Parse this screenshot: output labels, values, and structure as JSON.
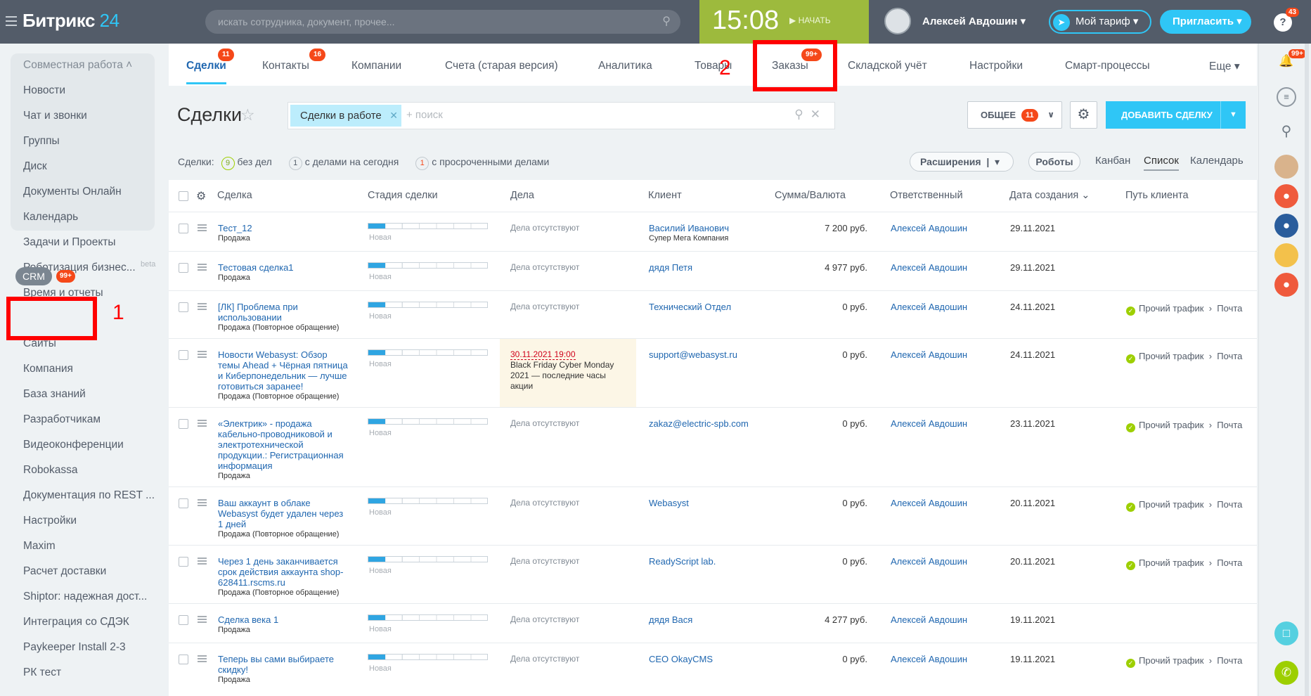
{
  "header": {
    "logo_main": "Битрикс",
    "logo_num": "24",
    "search_placeholder": "искать сотрудника, документ, прочее...",
    "clock_time": "15:08",
    "clock_start": "НАЧАТЬ",
    "user_name": "Алексей Авдошин",
    "tariff_label": "Мой тариф",
    "invite_label": "Пригласить",
    "help_badge": "43"
  },
  "leftnav": {
    "group_title": "Совместная работа",
    "group_items": [
      "Новости",
      "Чат и звонки",
      "Группы",
      "Диск",
      "Документы Онлайн",
      "Календарь"
    ],
    "items": [
      "Задачи и Проекты",
      "Роботизация бизнес...",
      "Время и отчеты"
    ],
    "beta": "beta",
    "crm_label": "CRM",
    "crm_badge": "99+",
    "items2": [
      "Сайты",
      "Компания",
      "База знаний",
      "Разработчикам",
      "Видеоконференции",
      "Robokassa",
      "Документация по REST ...",
      "Настройки",
      "Maxim",
      "Расчет доставки",
      "Shiptor: надежная дост...",
      "Интеграция со СДЭК",
      "Paykeeper Install 2-3",
      "РК тест"
    ]
  },
  "annotations": {
    "label1": "1",
    "label2": "2"
  },
  "tabs": [
    {
      "label": "Сделки",
      "badge": "11"
    },
    {
      "label": "Контакты",
      "badge": "16"
    },
    {
      "label": "Компании"
    },
    {
      "label": "Счета (старая версия)"
    },
    {
      "label": "Аналитика"
    },
    {
      "label": "Товары"
    },
    {
      "label": "Заказы",
      "badge": "99+"
    },
    {
      "label": "Складской учёт"
    },
    {
      "label": "Настройки"
    },
    {
      "label": "Смарт-процессы"
    },
    {
      "label": "Еще"
    }
  ],
  "toolbar": {
    "title": "Сделки",
    "filter_chip": "Сделки в работе",
    "filter_placeholder": "+ поиск",
    "general_label": "ОБЩЕЕ",
    "general_badge": "11",
    "add_label": "ДОБАВИТЬ СДЕЛКУ"
  },
  "counters": {
    "prefix": "Сделки:",
    "c1": "9",
    "t1": "без дел",
    "c2": "1",
    "t2": "с делами на сегодня",
    "c3": "1",
    "t3": "с просроченными делами"
  },
  "views": {
    "ext": "Расширения",
    "robots": "Роботы",
    "kanban": "Канбан",
    "list": "Список",
    "calendar": "Календарь"
  },
  "table": {
    "headers": [
      "Сделка",
      "Стадия сделки",
      "Дела",
      "Клиент",
      "Сумма/Валюта",
      "Ответственный",
      "Дата создания",
      "Путь клиента"
    ],
    "stage_label": "Новая",
    "no_acts": "Дела отсутствуют",
    "rows": [
      {
        "title": "Тест_12",
        "sub": "Продажа",
        "client": "Василий Иванович",
        "client_sub": "Супер Мега Компания",
        "sum": "7 200 руб.",
        "resp": "Алексей Авдошин",
        "date": "29.11.2021",
        "path": ""
      },
      {
        "title": "Тестовая сделка1",
        "sub": "Продажа",
        "client": "дядя Петя",
        "client_sub": "",
        "sum": "4 977 руб.",
        "resp": "Алексей Авдошин",
        "date": "29.11.2021",
        "path": ""
      },
      {
        "title": "[ЛК] Проблема при использовании",
        "sub": "Продажа (Повторное обращение)",
        "client": "Технический Отдел",
        "client_sub": "",
        "sum": "0 руб.",
        "resp": "Алексей Авдошин",
        "date": "24.11.2021",
        "path": "Прочий трафик",
        "path2": "Почта"
      },
      {
        "title": "Новости Webasyst: Обзор темы Ahead + Чёрная пятница и Киберпонедельник — лучше готовиться заранее!",
        "sub": "Продажа (Повторное обращение)",
        "act_date": "30.11.2021 19:00",
        "act_text": "Black Friday Cyber Monday 2021 — последние часы акции",
        "client": "support@webasyst.ru",
        "client_sub": "",
        "sum": "0 руб.",
        "resp": "Алексей Авдошин",
        "date": "24.11.2021",
        "path": "Прочий трафик",
        "path2": "Почта"
      },
      {
        "title": "«Электрик» - продажа кабельно-проводниковой и электротехнической продукции.: Регистрационная информация",
        "sub": "Продажа",
        "client": "zakaz@electric-spb.com",
        "client_sub": "",
        "sum": "0 руб.",
        "resp": "Алексей Авдошин",
        "date": "23.11.2021",
        "path": "Прочий трафик",
        "path2": "Почта"
      },
      {
        "title": "Ваш аккаунт в облаке Webasyst будет удален через 1 дней",
        "sub": "Продажа (Повторное обращение)",
        "client": "Webasyst",
        "client_sub": "",
        "sum": "0 руб.",
        "resp": "Алексей Авдошин",
        "date": "20.11.2021",
        "path": "Прочий трафик",
        "path2": "Почта"
      },
      {
        "title": "Через 1 день заканчивается срок действия аккаунта shop-628411.rscms.ru",
        "sub": "Продажа (Повторное обращение)",
        "client": "ReadyScript lab.",
        "client_sub": "",
        "sum": "0 руб.",
        "resp": "Алексей Авдошин",
        "date": "20.11.2021",
        "path": "Прочий трафик",
        "path2": "Почта"
      },
      {
        "title": "Сделка века 1",
        "sub": "Продажа",
        "client": "дядя Вася",
        "client_sub": "",
        "sum": "4 277 руб.",
        "resp": "Алексей Авдошин",
        "date": "19.11.2021",
        "path": ""
      },
      {
        "title": "Теперь вы сами выбираете скидку!",
        "sub": "Продажа",
        "client": "CEO OkayCMS",
        "client_sub": "",
        "sum": "0 руб.",
        "resp": "Алексей Авдошин",
        "date": "19.11.2021",
        "path": "Прочий трафик",
        "path2": "Почта"
      }
    ]
  },
  "rightbar": {
    "bell_badge": "99+"
  }
}
